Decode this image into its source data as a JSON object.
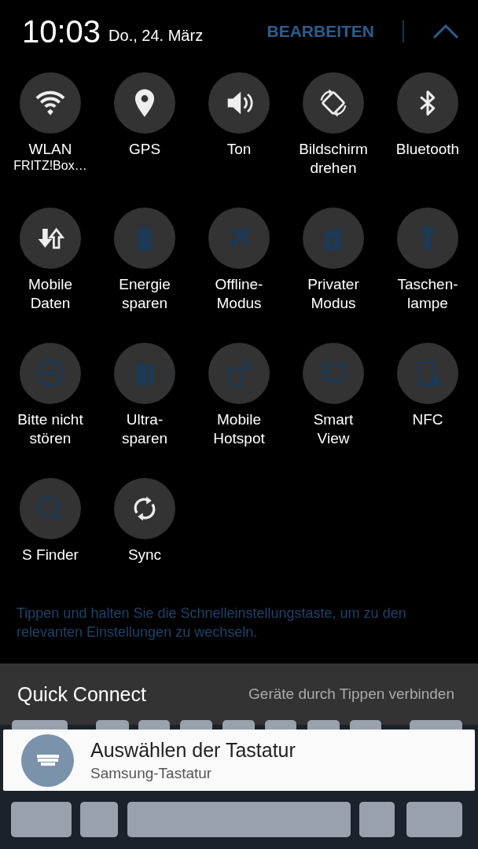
{
  "header": {
    "time": "10:03",
    "date": "Do., 24. März",
    "edit_button": "BEARBEITEN"
  },
  "tiles": [
    {
      "kind": "wifi",
      "label": "WLAN",
      "sublabel": "FRITZ!Box…",
      "on": true
    },
    {
      "kind": "location",
      "label": "GPS",
      "on": true
    },
    {
      "kind": "sound",
      "label": "Ton",
      "on": true
    },
    {
      "kind": "rotate",
      "label": "Bildschirm\ndrehen",
      "on": true
    },
    {
      "kind": "bluetooth",
      "label": "Bluetooth",
      "on": true
    },
    {
      "kind": "data",
      "label": "Mobile\nDaten",
      "on": true
    },
    {
      "kind": "battery",
      "label": "Energie\nsparen",
      "on": false
    },
    {
      "kind": "airplane",
      "label": "Offline-\nModus",
      "on": false
    },
    {
      "kind": "private",
      "label": "Privater\nModus",
      "on": false
    },
    {
      "kind": "flashlight",
      "label": "Taschen-\nlampe",
      "on": false
    },
    {
      "kind": "dnd",
      "label": "Bitte nicht\nstören",
      "on": false
    },
    {
      "kind": "ultra",
      "label": "Ultra-\nsparen",
      "on": false
    },
    {
      "kind": "hotspot",
      "label": "Mobile\nHotspot",
      "on": false
    },
    {
      "kind": "screen",
      "label": "Smart\nView",
      "on": false
    },
    {
      "kind": "nfc",
      "label": "NFC",
      "on": false
    },
    {
      "kind": "search",
      "label": "S Finder",
      "on": false
    },
    {
      "kind": "sync",
      "label": "Sync",
      "on": true
    }
  ],
  "hint": "Tippen und halten Sie die Schnelleinstellungstaste, um zu den relevanten Einstellungen zu wechseln.",
  "quick_connect": {
    "title": "Quick Connect",
    "action": "Geräte durch Tippen verbinden"
  },
  "notification": {
    "title": "Auswählen der Tastatur",
    "subtitle": "Samsung-Tastatur"
  }
}
